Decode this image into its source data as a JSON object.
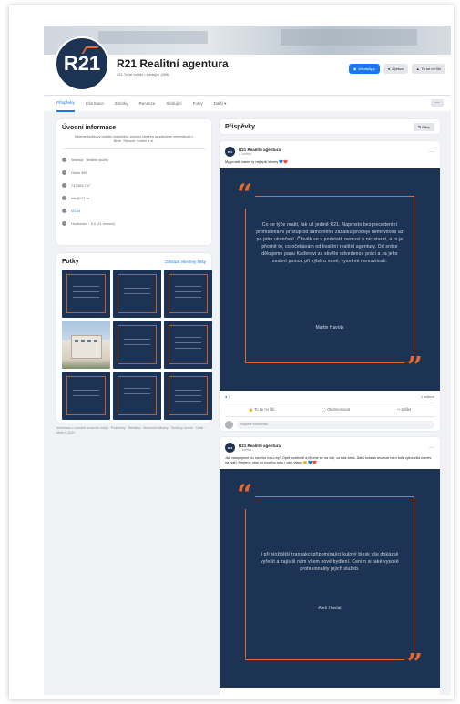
{
  "header": {
    "page_name": "R21 Realitní agentura",
    "page_subtitle": "201 To se mi líbí • sledující (458)",
    "logo_text": "R21",
    "buttons": {
      "whatsapp": "WhatsApp",
      "message": "Zpráva",
      "like": "To se mi líbí"
    }
  },
  "tabs": [
    "Příspěvky",
    "Informace",
    "Zmínky",
    "Recenze",
    "Sledující",
    "Fotky",
    "Další ▾"
  ],
  "intro": {
    "title": "Úvodní informace",
    "description": "Děláme špičkový realitní marketing, pomocí kterého prodáváme nemovitosti v Brně, Tišnově, Kuřimi a ol.",
    "rows": [
      {
        "icon": "page-icon",
        "label": "Stránka · Realitní služby"
      },
      {
        "icon": "location-icon",
        "label": "Okrès 495"
      },
      {
        "icon": "phone-icon",
        "label": "737 863 757"
      },
      {
        "icon": "email-icon",
        "label": "info@r21.cz"
      },
      {
        "icon": "web-icon",
        "label": "r21.cz"
      },
      {
        "icon": "rating-icon",
        "label": "Hodnocení · 5,0 (21 recenzí)"
      }
    ]
  },
  "photos": {
    "title": "Fotky",
    "see_all": "Zobrazit všechny fotky"
  },
  "footer_text": "Informace o ochraně osobních údajů · Podmínky · Reklama · Možnosti reklamy · Soubory cookie · Další · Meta © 2024",
  "posts_header": {
    "title": "Příspěvky",
    "filter": "Filtry"
  },
  "post1": {
    "author": "R21 Realitní agentura",
    "date": "1. května",
    "text": "My prostě máme ty nejlepší klienty 💙❤️",
    "quote": "Co se týče realit, tak už jedině R21. Naprosto bezprecedentní profesionální přístup od samotného začátku prodeje nemovitosti až po jeho ukončení. Člověk se v podstatě nemusí o nic starat, a to je přesně to, co očekávám od kvalitní realitní agentury. Od srdce děkujeme panu Kaďerovi za skvěle odvedenou práci a za jeho osobní pomoc při výběru nové, vysněné nemovitosti.",
    "quote_author": "Martin Havrák",
    "reactions": "2",
    "shares": "1 sdílení",
    "actions": {
      "like": "To se mi líbí",
      "comment": "Okomentovat",
      "share": "Sdílet"
    },
    "comment_placeholder": "Napište komentář..."
  },
  "post2": {
    "author": "R21 Realitní agentura",
    "date": "1. května",
    "text": "Jak vstupujeme do nového roku my? Opět pozitivně a těšíme se na vše, co nás čeká. Další krásná recenze nám totiž vykouzlila úsměv na tváři. Přejeme vám do nového roku i vám všem 😊 💙❤️",
    "quote": "I při složitější transakci připomínající kulový blesk vše dokázali vyřešit a zajistili nám všem nové bydlení. Cením si také vysoké profesionality jejich služeb.",
    "quote_author": "Aleš Havlát"
  },
  "colors": {
    "navy": "#1d3353",
    "orange": "#e8672a",
    "fb_blue": "#1877f2"
  }
}
